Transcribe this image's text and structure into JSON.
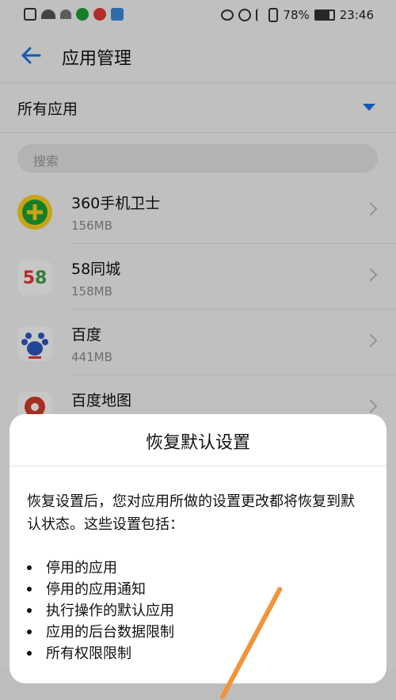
{
  "status": {
    "battery": "78%",
    "time": "23:46"
  },
  "appbar": {
    "title": "应用管理"
  },
  "filter": {
    "label": "所有应用"
  },
  "search": {
    "placeholder": "搜索"
  },
  "apps": [
    {
      "name": "360手机卫士",
      "size": "156MB",
      "icon": "360-security-icon",
      "color": "#1aa335"
    },
    {
      "name": "58同城",
      "size": "158MB",
      "icon": "58-tongcheng-icon",
      "color": "#e53935"
    },
    {
      "name": "百度",
      "size": "441MB",
      "icon": "baidu-paw-icon",
      "color": "#2b59c3"
    },
    {
      "name": "百度地图",
      "size": "",
      "icon": "baidu-map-icon",
      "color": "#d33b2c"
    }
  ],
  "dialog": {
    "title": "恢复默认设置",
    "body": "恢复设置后，您对应用所做的设置更改都将恢复到默认状态。这些设置包括：",
    "bullets": [
      "停用的应用",
      "停用的应用通知",
      "执行操作的默认应用",
      "应用的后台数据限制",
      "所有权限限制"
    ]
  },
  "colors": {
    "accent": "#1a73e8",
    "annotation_stroke": "#f2933b"
  }
}
